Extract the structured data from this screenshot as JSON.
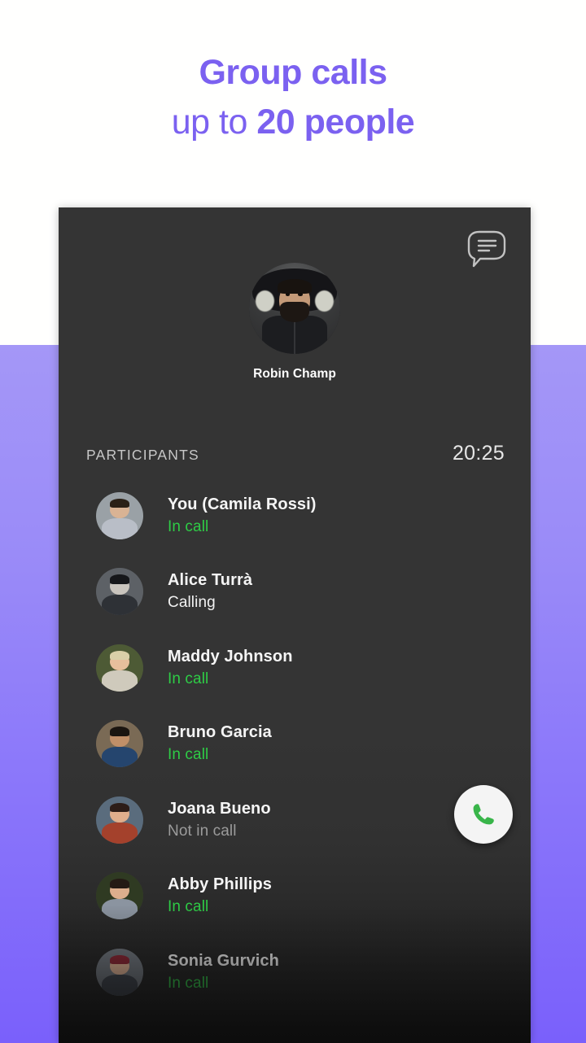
{
  "promo": {
    "headline_line1": "Group calls",
    "headline_line2_light": "up to ",
    "headline_line2_strong": "20 people",
    "accent_color": "#7b61f0",
    "background_top_color": "#fffffe",
    "background_bottom_gradient": [
      "#a497f7",
      "#7a60fb"
    ]
  },
  "screen": {
    "card_background": "#343434",
    "chat_icon": "chat-bubble-icon",
    "caller": {
      "name": "Robin Champ",
      "avatar": "caller-avatar-photo"
    },
    "section": {
      "label": "PARTICIPANTS",
      "timer": "20:25"
    },
    "answer_button": {
      "icon": "phone-handset-icon",
      "icon_color": "#39b54a",
      "background_color": "#f4f4f4"
    },
    "status_colors": {
      "in_call": "#2ecc46",
      "calling": "#f2f2f2",
      "not_in_call": "#9b9b9b"
    },
    "participants": [
      {
        "name": "You (Camila Rossi)",
        "status": "In call",
        "status_type": "in-call",
        "avatar": "avatar-camila-rossi",
        "hair": "#2b2117",
        "skin": "#d9b394",
        "shirt": "#b9bec7",
        "bg": "#9aa1a6"
      },
      {
        "name": "Alice Turrà",
        "status": "Calling",
        "status_type": "calling",
        "avatar": "avatar-alice-turra",
        "hair": "#16171a",
        "skin": "#c9c4bd",
        "shirt": "#2e3136",
        "bg": "#5d6166"
      },
      {
        "name": "Maddy Johnson",
        "status": "In call",
        "status_type": "in-call",
        "avatar": "avatar-maddy-johnson",
        "hair": "#d9cfa8",
        "skin": "#e7bf9c",
        "shirt": "#cfcabc",
        "bg": "#4d5a35"
      },
      {
        "name": "Bruno Garcia",
        "status": "In call",
        "status_type": "in-call",
        "avatar": "avatar-bruno-garcia",
        "hair": "#1b1510",
        "skin": "#c08f68",
        "shirt": "#25456e",
        "bg": "#7a6a55"
      },
      {
        "name": "Joana Bueno",
        "status": "Not in call",
        "status_type": "not-in-call",
        "avatar": "avatar-joana-bueno",
        "hair": "#2d1d18",
        "skin": "#e0ae8c",
        "shirt": "#a4412c",
        "bg": "#5a6c7d"
      },
      {
        "name": "Abby Phillips",
        "status": "In call",
        "status_type": "in-call",
        "avatar": "avatar-abby-phillips",
        "hair": "#241a14",
        "skin": "#dcae8d",
        "shirt": "#8b94a0",
        "bg": "#2f3a22"
      },
      {
        "name": "Sonia Gurvich",
        "status": "In call",
        "status_type": "in-call",
        "avatar": "avatar-sonia-gurvich",
        "hair": "#8c2231",
        "skin": "#e3b394",
        "shirt": "#3a3f48",
        "bg": "#6e747c"
      }
    ]
  }
}
